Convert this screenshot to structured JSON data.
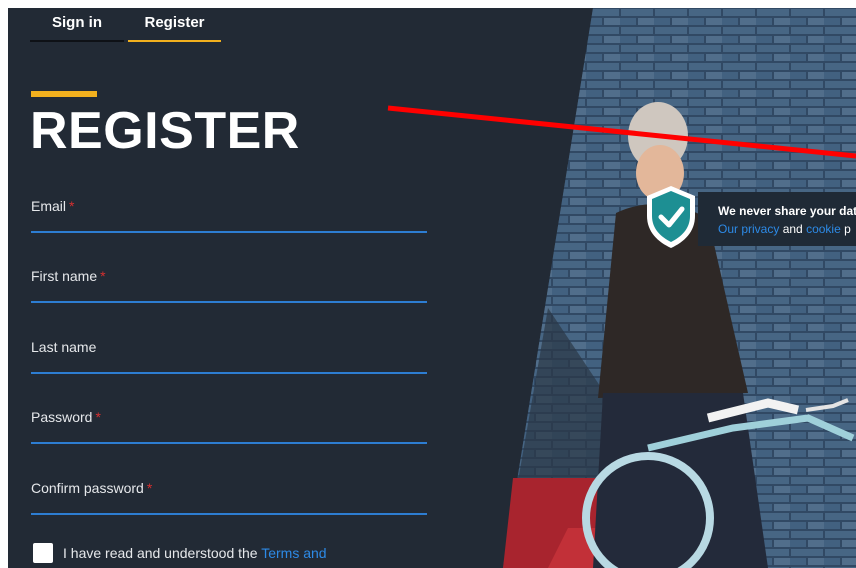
{
  "tabs": {
    "signin": "Sign in",
    "register": "Register"
  },
  "heading": "REGISTER",
  "form": {
    "fields": [
      {
        "label": "Email",
        "required": true
      },
      {
        "label": "First name",
        "required": true
      },
      {
        "label": "Last name",
        "required": false
      },
      {
        "label": "Password",
        "required": true
      },
      {
        "label": "Confirm password",
        "required": true
      }
    ],
    "required_mark": "*",
    "terms_prefix": "I have read and understood the ",
    "terms_link": "Terms and"
  },
  "privacy": {
    "line1": "We never share your dat",
    "privacy_link": "Our privacy",
    "and_text": " and ",
    "cookie_link": "cookie",
    "tail": " p"
  },
  "icons": {
    "shield": "shield-check-icon"
  },
  "colors": {
    "panel_bg": "#222a35",
    "accent": "#f2b01e",
    "input_underline": "#2d7dd2",
    "link": "#2d8ae6",
    "required": "#d62f2f",
    "shield": "#1d8f93",
    "annotation_line": "#ff0000"
  }
}
